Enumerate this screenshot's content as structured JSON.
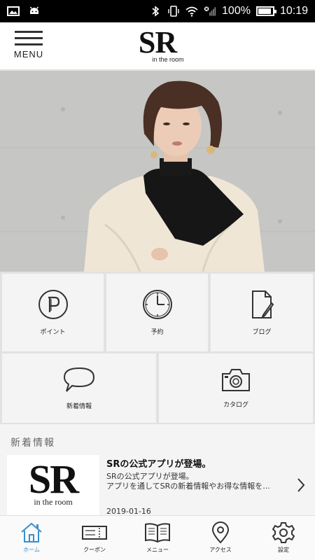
{
  "status_bar": {
    "battery": "100%",
    "time": "10:19",
    "battery_level": 1.0
  },
  "header": {
    "menu_label": "MENU",
    "logo": "SR",
    "logo_sub": "in the room"
  },
  "tiles": [
    {
      "label": "ポイント",
      "icon": "point-icon"
    },
    {
      "label": "予約",
      "icon": "clock-icon"
    },
    {
      "label": "ブログ",
      "icon": "document-pen-icon"
    },
    {
      "label": "新着情報",
      "icon": "speech-bubble-icon"
    },
    {
      "label": "カタログ",
      "icon": "camera-icon"
    }
  ],
  "news": {
    "header": "新着情報",
    "item": {
      "thumb_logo": "SR",
      "thumb_sub": "in the room",
      "title": "SRの公式アプリが登場。",
      "summary": "SRの公式アプリが登場。\nアプリを通してSRの新着情報やお得な情報を...",
      "date": "2019-01-16"
    }
  },
  "bottom_nav": [
    {
      "label": "ホーム",
      "icon": "home-icon",
      "active": true
    },
    {
      "label": "クーポン",
      "icon": "ticket-icon",
      "active": false
    },
    {
      "label": "メニュー",
      "icon": "book-icon",
      "active": false
    },
    {
      "label": "アクセス",
      "icon": "map-pin-icon",
      "active": false
    },
    {
      "label": "設定",
      "icon": "gear-icon",
      "active": false
    }
  ],
  "colors": {
    "accent": "#3a8fd0",
    "tile_bg": "#f4f4f4",
    "grid_gap": "#e2e2e2"
  }
}
